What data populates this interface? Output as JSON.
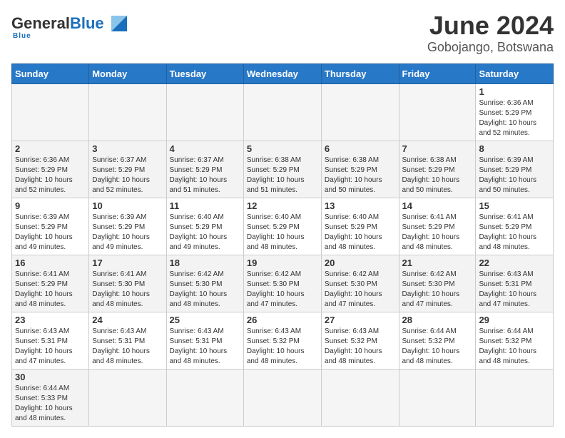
{
  "header": {
    "logo_general": "General",
    "logo_blue": "Blue",
    "month_title": "June 2024",
    "location": "Gobojango, Botswana"
  },
  "weekdays": [
    "Sunday",
    "Monday",
    "Tuesday",
    "Wednesday",
    "Thursday",
    "Friday",
    "Saturday"
  ],
  "weeks": [
    [
      {
        "day": "",
        "info": ""
      },
      {
        "day": "",
        "info": ""
      },
      {
        "day": "",
        "info": ""
      },
      {
        "day": "",
        "info": ""
      },
      {
        "day": "",
        "info": ""
      },
      {
        "day": "",
        "info": ""
      },
      {
        "day": "1",
        "info": "Sunrise: 6:36 AM\nSunset: 5:29 PM\nDaylight: 10 hours and 52 minutes."
      }
    ],
    [
      {
        "day": "2",
        "info": "Sunrise: 6:36 AM\nSunset: 5:29 PM\nDaylight: 10 hours and 52 minutes."
      },
      {
        "day": "3",
        "info": "Sunrise: 6:37 AM\nSunset: 5:29 PM\nDaylight: 10 hours and 52 minutes."
      },
      {
        "day": "4",
        "info": "Sunrise: 6:37 AM\nSunset: 5:29 PM\nDaylight: 10 hours and 51 minutes."
      },
      {
        "day": "5",
        "info": "Sunrise: 6:38 AM\nSunset: 5:29 PM\nDaylight: 10 hours and 51 minutes."
      },
      {
        "day": "6",
        "info": "Sunrise: 6:38 AM\nSunset: 5:29 PM\nDaylight: 10 hours and 50 minutes."
      },
      {
        "day": "7",
        "info": "Sunrise: 6:38 AM\nSunset: 5:29 PM\nDaylight: 10 hours and 50 minutes."
      },
      {
        "day": "8",
        "info": "Sunrise: 6:39 AM\nSunset: 5:29 PM\nDaylight: 10 hours and 50 minutes."
      }
    ],
    [
      {
        "day": "9",
        "info": "Sunrise: 6:39 AM\nSunset: 5:29 PM\nDaylight: 10 hours and 49 minutes."
      },
      {
        "day": "10",
        "info": "Sunrise: 6:39 AM\nSunset: 5:29 PM\nDaylight: 10 hours and 49 minutes."
      },
      {
        "day": "11",
        "info": "Sunrise: 6:40 AM\nSunset: 5:29 PM\nDaylight: 10 hours and 49 minutes."
      },
      {
        "day": "12",
        "info": "Sunrise: 6:40 AM\nSunset: 5:29 PM\nDaylight: 10 hours and 48 minutes."
      },
      {
        "day": "13",
        "info": "Sunrise: 6:40 AM\nSunset: 5:29 PM\nDaylight: 10 hours and 48 minutes."
      },
      {
        "day": "14",
        "info": "Sunrise: 6:41 AM\nSunset: 5:29 PM\nDaylight: 10 hours and 48 minutes."
      },
      {
        "day": "15",
        "info": "Sunrise: 6:41 AM\nSunset: 5:29 PM\nDaylight: 10 hours and 48 minutes."
      }
    ],
    [
      {
        "day": "16",
        "info": "Sunrise: 6:41 AM\nSunset: 5:29 PM\nDaylight: 10 hours and 48 minutes."
      },
      {
        "day": "17",
        "info": "Sunrise: 6:41 AM\nSunset: 5:30 PM\nDaylight: 10 hours and 48 minutes."
      },
      {
        "day": "18",
        "info": "Sunrise: 6:42 AM\nSunset: 5:30 PM\nDaylight: 10 hours and 48 minutes."
      },
      {
        "day": "19",
        "info": "Sunrise: 6:42 AM\nSunset: 5:30 PM\nDaylight: 10 hours and 47 minutes."
      },
      {
        "day": "20",
        "info": "Sunrise: 6:42 AM\nSunset: 5:30 PM\nDaylight: 10 hours and 47 minutes."
      },
      {
        "day": "21",
        "info": "Sunrise: 6:42 AM\nSunset: 5:30 PM\nDaylight: 10 hours and 47 minutes."
      },
      {
        "day": "22",
        "info": "Sunrise: 6:43 AM\nSunset: 5:31 PM\nDaylight: 10 hours and 47 minutes."
      }
    ],
    [
      {
        "day": "23",
        "info": "Sunrise: 6:43 AM\nSunset: 5:31 PM\nDaylight: 10 hours and 47 minutes."
      },
      {
        "day": "24",
        "info": "Sunrise: 6:43 AM\nSunset: 5:31 PM\nDaylight: 10 hours and 48 minutes."
      },
      {
        "day": "25",
        "info": "Sunrise: 6:43 AM\nSunset: 5:31 PM\nDaylight: 10 hours and 48 minutes."
      },
      {
        "day": "26",
        "info": "Sunrise: 6:43 AM\nSunset: 5:32 PM\nDaylight: 10 hours and 48 minutes."
      },
      {
        "day": "27",
        "info": "Sunrise: 6:43 AM\nSunset: 5:32 PM\nDaylight: 10 hours and 48 minutes."
      },
      {
        "day": "28",
        "info": "Sunrise: 6:44 AM\nSunset: 5:32 PM\nDaylight: 10 hours and 48 minutes."
      },
      {
        "day": "29",
        "info": "Sunrise: 6:44 AM\nSunset: 5:32 PM\nDaylight: 10 hours and 48 minutes."
      }
    ],
    [
      {
        "day": "30",
        "info": "Sunrise: 6:44 AM\nSunset: 5:33 PM\nDaylight: 10 hours and 48 minutes."
      },
      {
        "day": "",
        "info": ""
      },
      {
        "day": "",
        "info": ""
      },
      {
        "day": "",
        "info": ""
      },
      {
        "day": "",
        "info": ""
      },
      {
        "day": "",
        "info": ""
      },
      {
        "day": "",
        "info": ""
      }
    ]
  ]
}
